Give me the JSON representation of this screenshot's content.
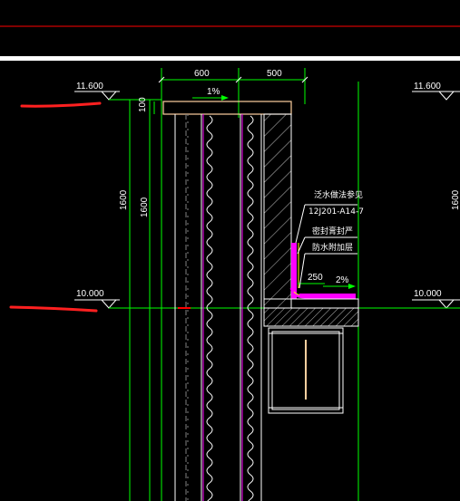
{
  "colors": {
    "background": "#000000",
    "white": "#ffffff",
    "green": "#00ff00",
    "red": "#ff2020",
    "red_line": "#ff0000",
    "magenta": "#ff00ff",
    "yellow": "#ffff00",
    "gray": "#808080",
    "orange": "#ffd0a0"
  },
  "elevations": {
    "top_left": "11.600",
    "top_right": "11.600",
    "bottom_left": "10.000",
    "bottom_right": "10.000"
  },
  "dimensions": {
    "top_width_1": "600",
    "top_width_2": "500",
    "slope_top": "1%",
    "slab_thickness": "100",
    "height_a": "1600",
    "height_b": "1600",
    "height_right": "1600",
    "corner_width": "250",
    "slope_bottom": "2%"
  },
  "notes": {
    "line1": "泛水做法参见",
    "line2": "12J201-A14-7",
    "line3": "密封膏封严",
    "line4": "防水附加层"
  }
}
